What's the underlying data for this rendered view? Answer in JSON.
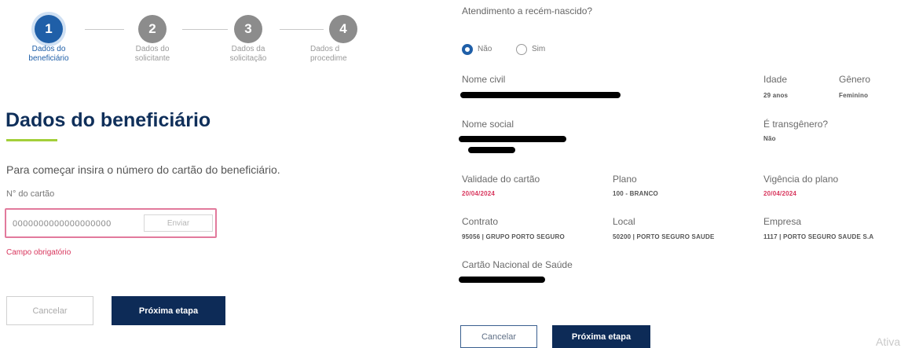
{
  "stepper": {
    "steps": [
      {
        "number": "1",
        "label_line1": "Dados do",
        "label_line2": "beneficiário"
      },
      {
        "number": "2",
        "label_line1": "Dados do",
        "label_line2": "solicitante"
      },
      {
        "number": "3",
        "label_line1": "Dados da",
        "label_line2": "solicitação"
      },
      {
        "number": "4",
        "label_line1": "Dados d",
        "label_line2": "procedime"
      }
    ]
  },
  "form": {
    "title": "Dados do beneficiário",
    "intro": "Para começar insira o número do cartão do beneficiário.",
    "card_label": "N° do cartão",
    "card_value": "0000000000000000000",
    "send_label": "Enviar",
    "error": "Campo obrigatório",
    "cancel_label": "Cancelar",
    "next_label": "Próxima etapa"
  },
  "details": {
    "newborn_question": "Atendimento a recém-nascido?",
    "newborn_options": {
      "no": "Não",
      "yes": "Sim"
    },
    "civil_name_label": "Nome civil",
    "age_label": "Idade",
    "age_value": "29 anos",
    "gender_label": "Gênero",
    "gender_value": "Feminino",
    "social_name_label": "Nome social",
    "transgender_label": "É transgênero?",
    "transgender_value": "Não",
    "card_validity_label": "Validade do cartão",
    "card_validity_value": "20/04/2024",
    "plan_label": "Plano",
    "plan_value": "100 - BRANCO",
    "plan_term_label": "Vigência do plano",
    "plan_term_value": "20/04/2024",
    "contract_label": "Contrato",
    "contract_value": "95056 | GRUPO PORTO SEGURO",
    "location_label": "Local",
    "location_value": "50200 | PORTO SEGURO SAUDE",
    "company_label": "Empresa",
    "company_value": "1117 | PORTO SEGURO SAUDE S.A",
    "sus_card_label": "Cartão Nacional de Saúde",
    "cancel_label": "Cancelar",
    "next_label": "Próxima etapa"
  },
  "watermark": "Ativa",
  "colors": {
    "primary": "#0d2b57",
    "active_step": "#1f5fa8",
    "accent_underline": "#a3cf3a",
    "error": "#d8365d"
  }
}
